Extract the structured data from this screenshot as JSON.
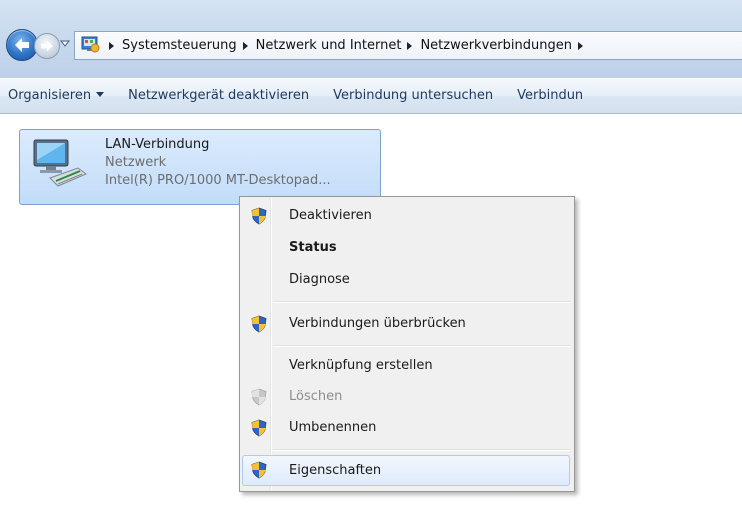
{
  "address_bar": {
    "breadcrumbs": [
      "Systemsteuerung",
      "Netzwerk und Internet",
      "Netzwerkverbindungen"
    ],
    "icons": [
      "back-arrow-icon",
      "forward-arrow-icon",
      "history-dropdown-icon",
      "control-panel-icon"
    ]
  },
  "toolbar": {
    "organize": "Organisieren",
    "disable": "Netzwerkgerät deaktivieren",
    "diagnose": "Verbindung untersuchen",
    "more": "Verbindun"
  },
  "connection": {
    "name": "LAN-Verbindung",
    "network": "Netzwerk",
    "adapter": "Intel(R) PRO/1000 MT-Desktopad..."
  },
  "context_menu": {
    "items": [
      {
        "label": "Deaktivieren",
        "icon": "uac-shield-icon"
      },
      {
        "label": "Status"
      },
      {
        "label": "Diagnose"
      },
      {
        "label": "Verbindungen überbrücken",
        "icon": "uac-shield-icon"
      },
      {
        "label": "Verknüpfung erstellen"
      },
      {
        "label": "Löschen",
        "icon": "uac-shield-icon",
        "disabled": true
      },
      {
        "label": "Umbenennen",
        "icon": "uac-shield-icon"
      },
      {
        "label": "Eigenschaften",
        "icon": "uac-shield-icon",
        "highlighted": true
      }
    ]
  },
  "colors": {
    "selection": "#c1dcf9",
    "menu_background": "#f0f0f0",
    "toolbar_text": "#1e395b"
  }
}
